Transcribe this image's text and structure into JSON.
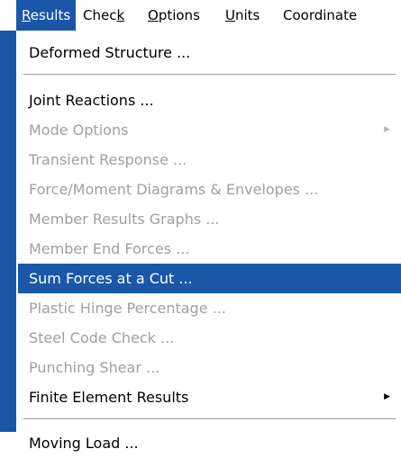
{
  "menubar": {
    "results": "Results",
    "results_mnemonic": "R",
    "results_rest": "esults",
    "check_pre": "Chec",
    "check_mnemonic": "k",
    "options_mnemonic": "O",
    "options_rest": "ptions",
    "units_mnemonic": "U",
    "units_rest": "nits",
    "coordinates": "Coordinate"
  },
  "menu": {
    "deformed_structure": "Deformed Structure ...",
    "joint_reactions": "Joint Reactions ...",
    "mode_options": "Mode Options",
    "transient_response": "Transient Response ...",
    "force_moment": "Force/Moment Diagrams & Envelopes ...",
    "member_results_graphs": "Member Results Graphs ...",
    "member_end_forces": "Member End Forces ...",
    "sum_forces": "Sum Forces at a Cut ...",
    "plastic_hinge": "Plastic Hinge Percentage ...",
    "steel_code": "Steel Code Check ...",
    "punching_shear": "Punching Shear ...",
    "finite_element": "Finite Element Results",
    "moving_load": "Moving Load ..."
  },
  "icons": {
    "submenu_arrow": "triangle-right-icon"
  },
  "colors": {
    "highlight": "#1a57a8",
    "disabled_text": "#a0a0a0"
  }
}
